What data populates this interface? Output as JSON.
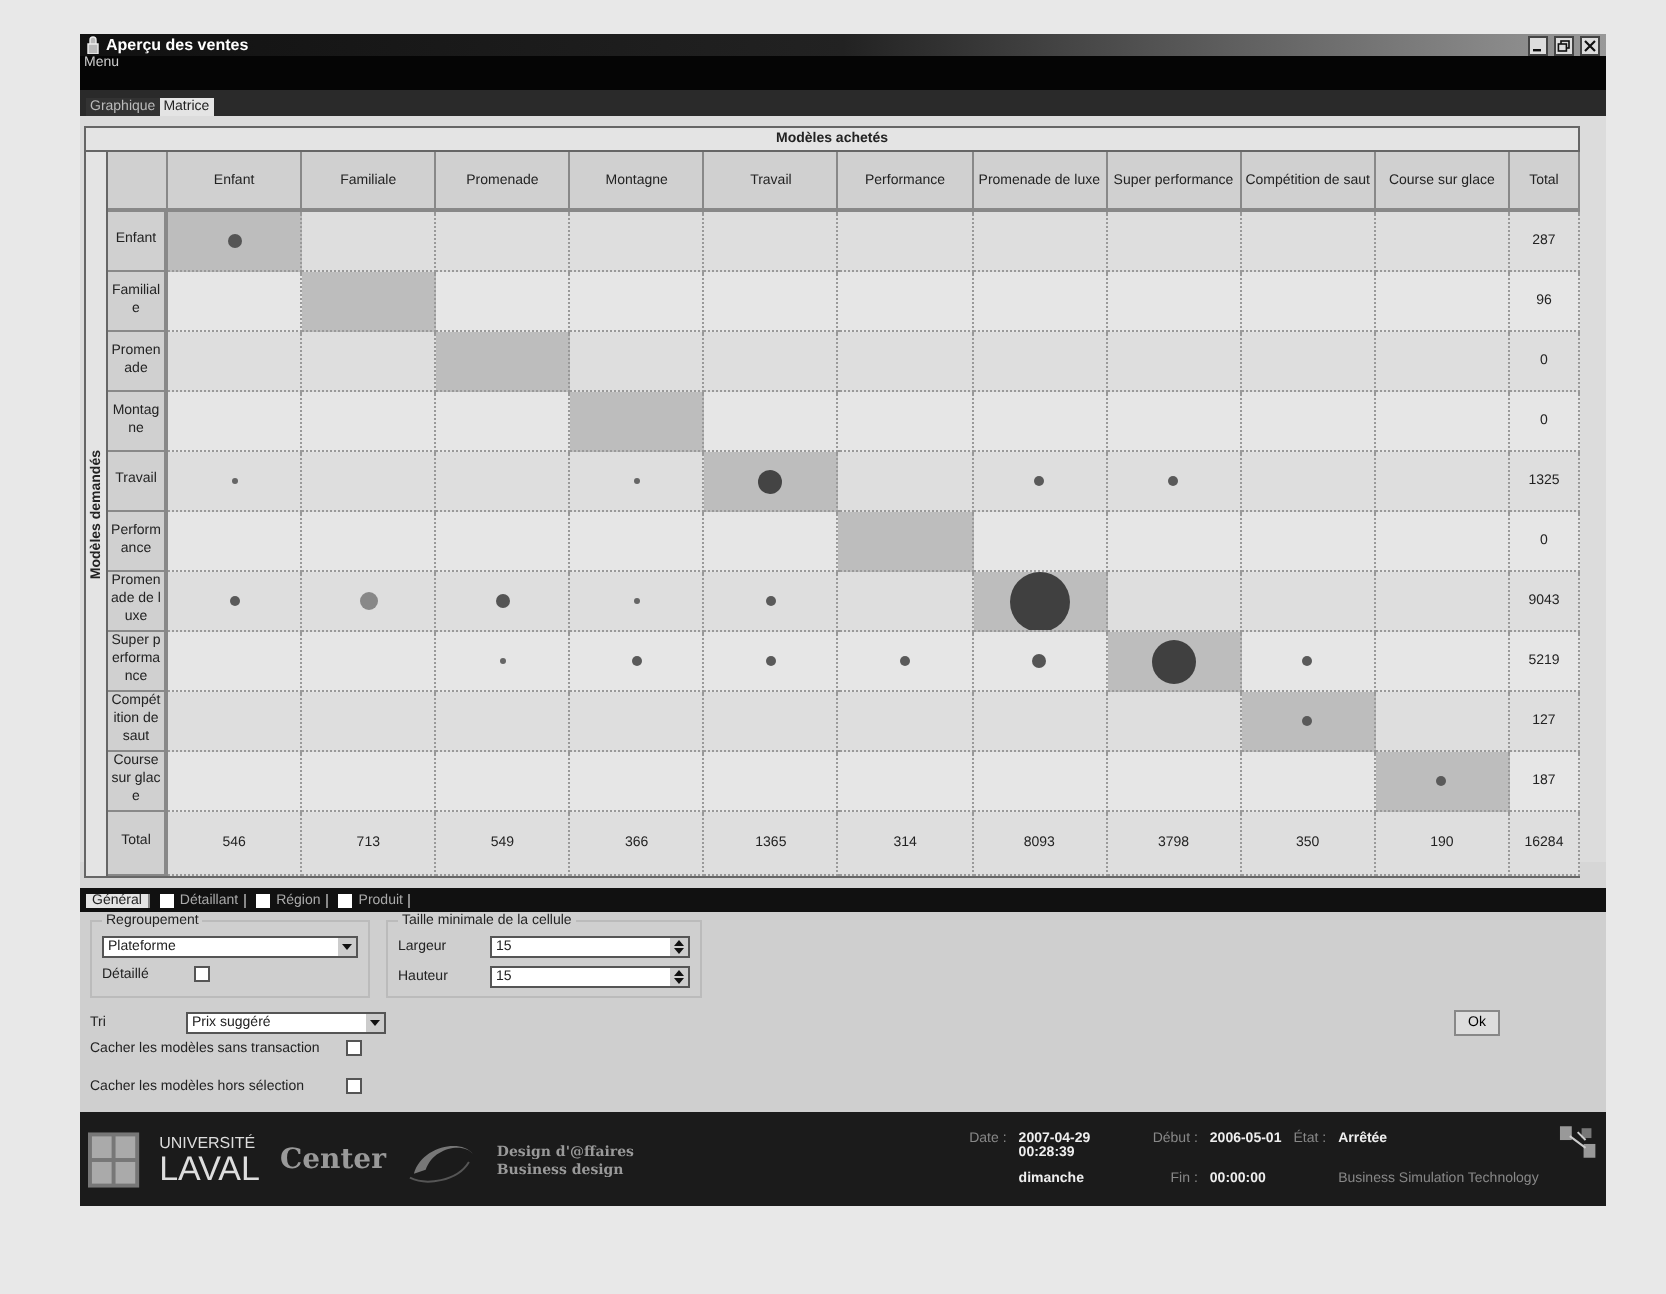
{
  "window": {
    "title": "Aperçu des ventes"
  },
  "menu": [
    "Menu"
  ],
  "tabs": [
    {
      "label": "Graphique",
      "selected": false
    },
    {
      "label": "Matrice",
      "selected": true
    }
  ],
  "matrix": {
    "title": "Modèles achetés",
    "row_axis": "Modèles demandés",
    "corner_total": "Total",
    "columns": [
      "Enfant",
      "Familiale",
      "Promenade",
      "Montagne",
      "Travail",
      "Performance",
      "Promenade de luxe",
      "Super performance",
      "Compétition de saut",
      "Course sur glace"
    ],
    "rows": [
      {
        "label": "Enfant",
        "total": "287",
        "cells": [
          {
            "highlighted": true,
            "kind": "medium"
          },
          {
            "highlighted": false
          },
          {
            "highlighted": false
          },
          {
            "highlighted": false
          },
          {
            "highlighted": false
          },
          {
            "highlighted": false
          },
          {
            "highlighted": false
          },
          {
            "highlighted": false
          },
          {
            "highlighted": false
          },
          {
            "highlighted": false
          }
        ]
      },
      {
        "label": "Familiale",
        "total": "96",
        "cells": [
          {
            "highlighted": false
          },
          {
            "highlighted": true
          },
          {
            "highlighted": false
          },
          {
            "highlighted": false
          },
          {
            "highlighted": false
          },
          {
            "highlighted": false
          },
          {
            "highlighted": false
          },
          {
            "highlighted": false
          },
          {
            "highlighted": false
          },
          {
            "highlighted": false
          }
        ]
      },
      {
        "label": "Promenade",
        "total": "0",
        "cells": [
          {
            "highlighted": false
          },
          {
            "highlighted": false
          },
          {
            "highlighted": true
          },
          {
            "highlighted": false
          },
          {
            "highlighted": false
          },
          {
            "highlighted": false
          },
          {
            "highlighted": false
          },
          {
            "highlighted": false
          },
          {
            "highlighted": false
          },
          {
            "highlighted": false
          }
        ]
      },
      {
        "label": "Montagne",
        "total": "0",
        "cells": [
          {
            "highlighted": false
          },
          {
            "highlighted": false
          },
          {
            "highlighted": false
          },
          {
            "highlighted": true
          },
          {
            "highlighted": false
          },
          {
            "highlighted": false
          },
          {
            "highlighted": false
          },
          {
            "highlighted": false
          },
          {
            "highlighted": false
          },
          {
            "highlighted": false
          }
        ]
      },
      {
        "label": "Travail",
        "total": "1325",
        "cells": [
          {
            "highlighted": false,
            "kind": "tiny"
          },
          {
            "highlighted": false
          },
          {
            "highlighted": false
          },
          {
            "highlighted": false,
            "kind": "tiny"
          },
          {
            "highlighted": true,
            "kind": "big"
          },
          {
            "highlighted": false
          },
          {
            "highlighted": false,
            "kind": "small"
          },
          {
            "highlighted": false,
            "kind": "small"
          },
          {
            "highlighted": false
          },
          {
            "highlighted": false
          }
        ]
      },
      {
        "label": "Performance",
        "total": "0",
        "cells": [
          {
            "highlighted": false
          },
          {
            "highlighted": false
          },
          {
            "highlighted": false
          },
          {
            "highlighted": false
          },
          {
            "highlighted": false
          },
          {
            "highlighted": true
          },
          {
            "highlighted": false
          },
          {
            "highlighted": false
          },
          {
            "highlighted": false
          },
          {
            "highlighted": false
          }
        ]
      },
      {
        "label": "Promenade de luxe",
        "total": "9043",
        "cells": [
          {
            "highlighted": false,
            "kind": "small"
          },
          {
            "highlighted": false,
            "kind": "large"
          },
          {
            "highlighted": false,
            "kind": "medium"
          },
          {
            "highlighted": false,
            "kind": "tiny"
          },
          {
            "highlighted": false,
            "kind": "small"
          },
          {
            "highlighted": false
          },
          {
            "highlighted": true,
            "kind": "giant"
          },
          {
            "highlighted": false
          },
          {
            "highlighted": false
          },
          {
            "highlighted": false
          }
        ]
      },
      {
        "label": "Super performance",
        "total": "5219",
        "cells": [
          {
            "highlighted": false
          },
          {
            "highlighted": false
          },
          {
            "highlighted": false,
            "kind": "tiny"
          },
          {
            "highlighted": false,
            "kind": "small"
          },
          {
            "highlighted": false,
            "kind": "small"
          },
          {
            "highlighted": false,
            "kind": "small"
          },
          {
            "highlighted": false,
            "kind": "medium"
          },
          {
            "highlighted": true,
            "kind": "huge"
          },
          {
            "highlighted": false,
            "kind": "small"
          },
          {
            "highlighted": false
          }
        ]
      },
      {
        "label": "Compétition de saut",
        "total": "127",
        "cells": [
          {
            "highlighted": false
          },
          {
            "highlighted": false
          },
          {
            "highlighted": false
          },
          {
            "highlighted": false
          },
          {
            "highlighted": false
          },
          {
            "highlighted": false
          },
          {
            "highlighted": false
          },
          {
            "highlighted": false
          },
          {
            "highlighted": true,
            "kind": "small"
          },
          {
            "highlighted": false
          }
        ]
      },
      {
        "label": "Course sur glace",
        "total": "187",
        "cells": [
          {
            "highlighted": false
          },
          {
            "highlighted": false
          },
          {
            "highlighted": false
          },
          {
            "highlighted": false
          },
          {
            "highlighted": false
          },
          {
            "highlighted": false
          },
          {
            "highlighted": false
          },
          {
            "highlighted": false
          },
          {
            "highlighted": false
          },
          {
            "highlighted": true,
            "kind": "small"
          }
        ]
      }
    ],
    "total_row": {
      "label": "Total",
      "values": [
        "546",
        "713",
        "549",
        "366",
        "1365",
        "314",
        "8093",
        "3798",
        "350",
        "190"
      ],
      "grand_total": "16284"
    }
  },
  "filter_tabs": [
    {
      "label": "Général",
      "selected": true
    },
    {
      "label": "Détaillant",
      "selected": false,
      "checked": false
    },
    {
      "label": "Région",
      "selected": false,
      "checked": false
    },
    {
      "label": "Produit",
      "selected": false,
      "checked": false
    }
  ],
  "form": {
    "grouping": {
      "title": "Regroupement",
      "value": "Plateforme",
      "detail_label": "Détaillé",
      "detail_checked": false
    },
    "cell_size": {
      "title": "Taille minimale de la cellule",
      "width_label": "Largeur",
      "width_value": "15",
      "height_label": "Hauteur",
      "height_value": "15"
    },
    "sort": {
      "label": "Tri",
      "value": "Prix suggéré"
    },
    "ok_button": "Ok",
    "options": [
      {
        "label": "Cacher les modèles sans transaction",
        "checked": false
      },
      {
        "label": "Cacher les modèles hors sélection",
        "checked": false
      }
    ]
  },
  "footer": {
    "university_top": "UNIVERSITÉ",
    "university_bottom": "LAVAL",
    "center": "Center",
    "design_fr": "Design d'@ffaires",
    "design_en": "Business design",
    "date_label": "Date :",
    "date_value": "2007-04-29 00:28:39",
    "day": "dimanche",
    "start_label": "Début :",
    "start_value": "2006-05-01",
    "end_label": "Fin :",
    "end_value": "00:00:00",
    "state_label": "État :",
    "state_value": "Arrêtée",
    "company": "Business Simulation Technology"
  }
}
